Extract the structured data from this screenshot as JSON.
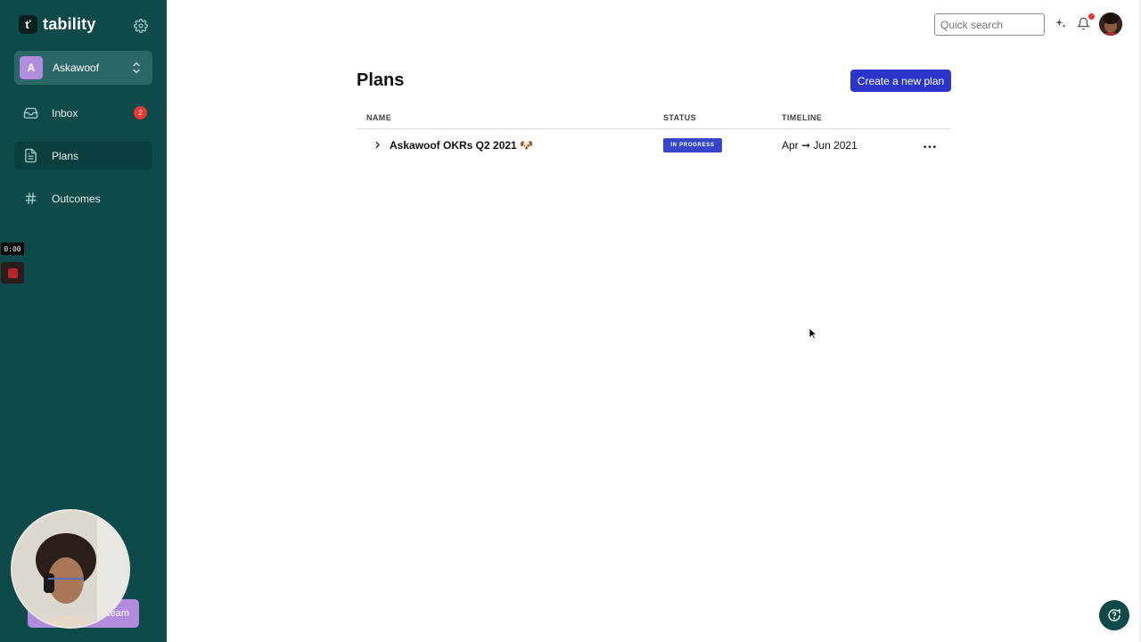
{
  "brand": {
    "name": "tability",
    "mark": "ť"
  },
  "workspace": {
    "avatar_letter": "A",
    "name": "Askawoof"
  },
  "nav": [
    {
      "label": "Inbox",
      "icon": "inbox-icon",
      "badge": "2",
      "active": false
    },
    {
      "label": "Plans",
      "icon": "document-icon",
      "active": true
    },
    {
      "label": "Outcomes",
      "icon": "hash-icon",
      "active": false
    }
  ],
  "recorder": {
    "time": "0:00"
  },
  "invite": {
    "label_visible": "team"
  },
  "topbar": {
    "search_placeholder": "Quick search"
  },
  "page": {
    "title": "Plans",
    "create_button": "Create a new plan"
  },
  "table": {
    "headers": {
      "name": "NAME",
      "status": "STATUS",
      "timeline": "TIMELINE"
    },
    "rows": [
      {
        "name": "Askawoof OKRs Q2 2021 🐶",
        "status": "IN PROGRESS",
        "timeline": "Apr ➞ Jun 2021"
      }
    ]
  },
  "colors": {
    "sidebar": "#0e4a4a",
    "primary": "#2b35c9",
    "badge": "#e53935",
    "workspace_avatar": "#b18bdc"
  }
}
